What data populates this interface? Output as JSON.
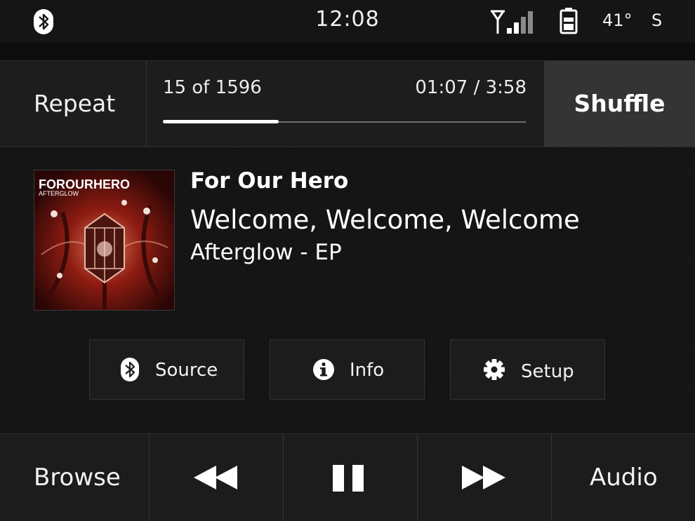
{
  "status_bar": {
    "time": "12:08",
    "temperature": "41°",
    "compass": "S",
    "icons": [
      "bluetooth-icon",
      "signal-icon",
      "battery-icon"
    ]
  },
  "transport": {
    "repeat_label": "Repeat",
    "track_index": "15 of 1596",
    "track_time": "01:07 / 3:58",
    "progress_fraction": 0.32,
    "shuffle_label": "Shuffle"
  },
  "now_playing": {
    "artist": "For Our Hero",
    "song": "Welcome, Welcome, Welcome",
    "album": "Afterglow - EP",
    "art_title": "FOROURHERO",
    "art_subtitle": "AFTERGLOW"
  },
  "actions": [
    {
      "label": "Source",
      "icon": "bluetooth-icon"
    },
    {
      "label": "Info",
      "icon": "info-icon"
    },
    {
      "label": "Setup",
      "icon": "gear-icon"
    }
  ],
  "bottom_nav": {
    "browse_label": "Browse",
    "audio_label": "Audio",
    "icons": [
      "rewind-icon",
      "pause-icon",
      "fast-forward-icon"
    ]
  },
  "colors": {
    "background": "#0b0b0b",
    "panel": "#1d1d1d",
    "active_panel": "#343434",
    "text": "#ffffff"
  }
}
